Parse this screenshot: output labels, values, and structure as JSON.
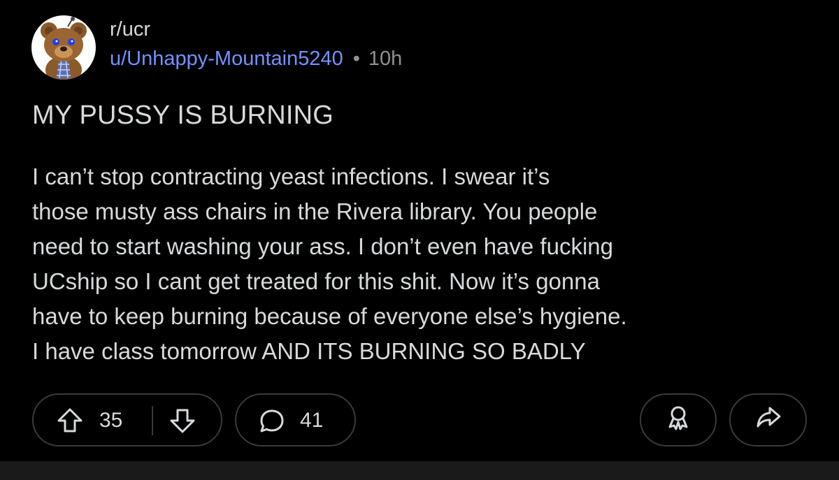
{
  "post": {
    "subreddit": "r/ucr",
    "username": "u/Unhappy-Mountain5240",
    "separator": "•",
    "time": "10h",
    "title": "MY PUSSY IS BURNING",
    "body_lines": [
      "I can’t stop contracting yeast infections.  I swear it’s",
      "those musty ass chairs in the Rivera library. You people",
      "need to start washing your ass. I don’t even have fucking",
      "UCship so I cant get treated for this shit.  Now it’s gonna",
      "have to keep burning because of everyone else’s hygiene.",
      "I have class tomorrow AND ITS BURNING SO BADLY"
    ]
  },
  "actions": {
    "upvote_icon": "upvote-arrow-icon",
    "score": "35",
    "downvote_icon": "downvote-arrow-icon",
    "comment_icon": "comment-bubble-icon",
    "comments": "41",
    "award_icon": "award-icon",
    "share_icon": "share-arrow-icon"
  },
  "colors": {
    "background": "#000000",
    "text": "#d7dadc",
    "username": "#7193ff",
    "muted": "#8f9193",
    "pill_border": "#3a3a3c"
  },
  "avatar": {
    "icon": "snoo-bear-avatar-icon"
  }
}
